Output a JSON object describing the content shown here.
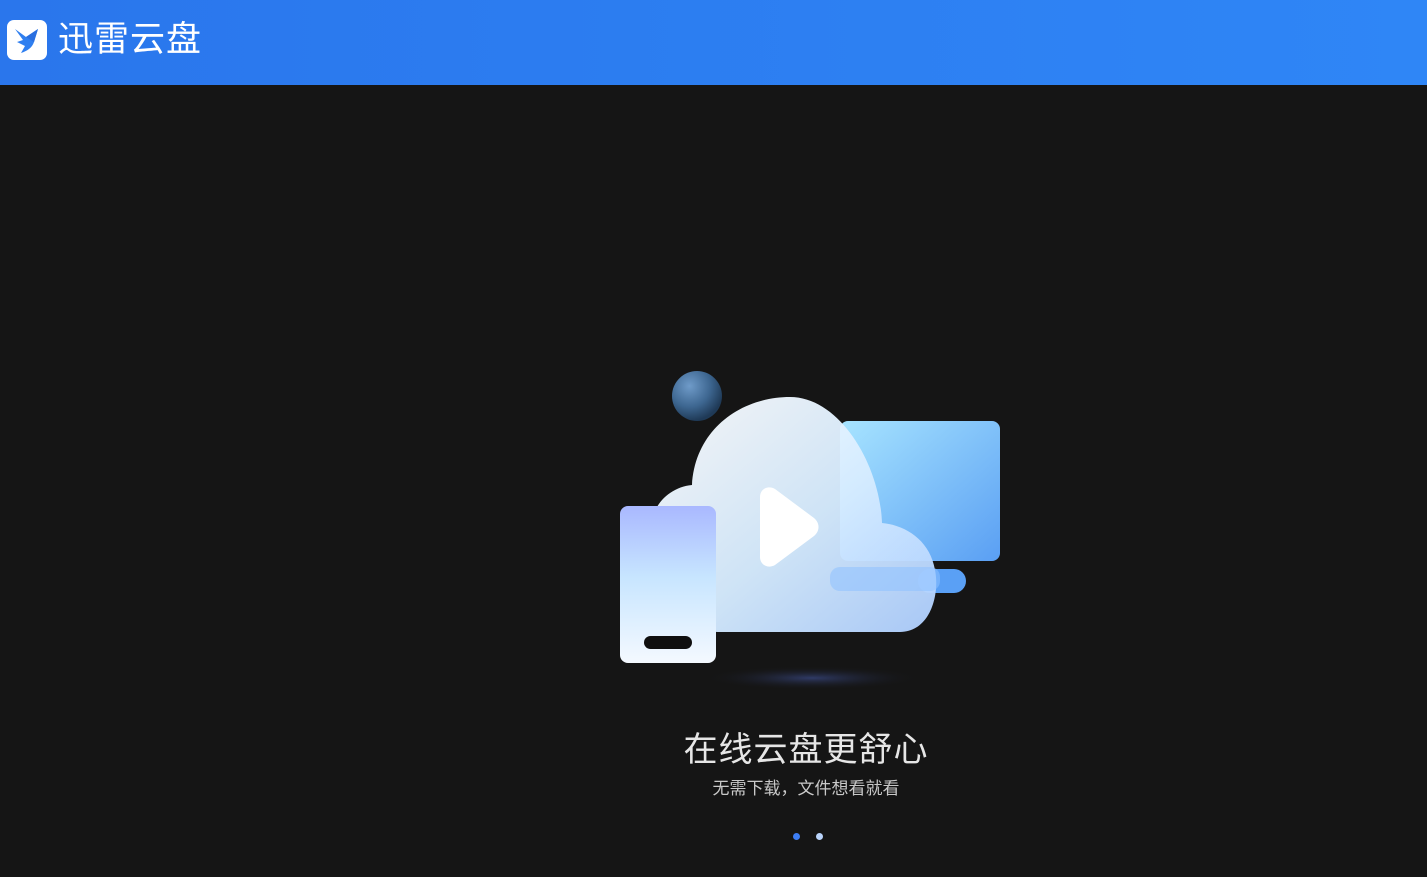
{
  "app": {
    "brand_name": "迅雷云盘",
    "logo_icon": "thunder-bird-logo-icon"
  },
  "colors": {
    "header_gradient_start": "#2a76ec",
    "header_gradient_end": "#2f86f6",
    "background": "#151515",
    "dot_active": "#3d7ef5",
    "dot_inactive": "#b9d3fb"
  },
  "onboarding": {
    "illustration": "cloud-video-devices-illustration",
    "title": "在线云盘更舒心",
    "subtitle": "无需下载，文件想看就看",
    "pagination": {
      "total": 2,
      "current": 1
    }
  }
}
